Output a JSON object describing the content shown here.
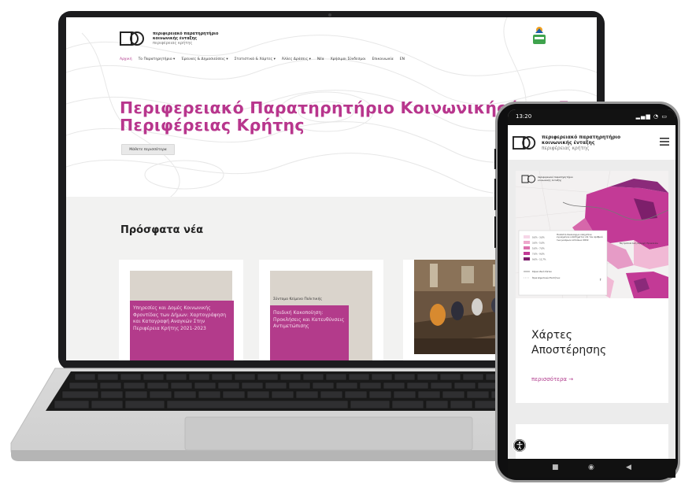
{
  "laptop": {
    "site": {
      "logo_line1": "περιφερειακό παρατηρητήριο",
      "logo_line2": "κοινωνικής ένταξης",
      "logo_line3": "περιφέρειας κρήτης",
      "nav": [
        "Αρχική",
        "Το Παρατηρητήριο ▾",
        "Έρευνες & Δημοσιεύσεις ▾",
        "Στατιστικά & Χάρτες ▾",
        "Άλλες Δράσεις ▾",
        "Νέα",
        "Χρήσιμοι Σύνδεσμοι",
        "Επικοινωνία",
        "EN"
      ],
      "hero_title_line1": "Περιφερειακό Παρατηρητήριο Κοινωνικής Ένταξης",
      "hero_title_line2": "Περιφέρειας Κρήτης",
      "hero_button": "Μάθετε περισσότερα",
      "news_heading": "Πρόσφατα νέα",
      "cards": [
        {
          "category": "",
          "title": "Υπηρεσίες και Δομές Κοινωνικής Φροντίδας των Δήμων: Χαρτογράφηση και Καταγραφή Αναγκών Στην Περιφέρεια Κρήτης 2021-2023"
        },
        {
          "category": "Σύντομο Κείμενο Πολιτικής",
          "title": "Παιδική Κακοποίηση: Προκλήσεις και Κατευθύνσεις Αντιμετώπισης"
        },
        {
          "category": "",
          "title": ""
        }
      ]
    }
  },
  "phone": {
    "time": "13:20",
    "logo_line1": "περιφερειακό παρατηρητήριο",
    "logo_line2": "κοινωνικής ένταξης",
    "logo_line3": "περιφέρειας κρήτης",
    "map": {
      "mini_logo_l1": "περιφερειακό παρατηρητήριο",
      "mini_logo_l2": "κοινωνικής ένταξης",
      "legend_title": "Ποσοστό δικαιούχων ελάχιστου εγγυημένου εισοδήματος επί του αριθμού των μονίμων κατοίκων 2019",
      "legend_items": [
        "0,0% - 3,0%",
        "3,0% - 5,0%",
        "5,0% - 7,0%",
        "7,0% - 9,0%",
        "9,0% - 11,7%"
      ],
      "legend_extra": [
        "Κύρια οδικό δίκτυο",
        "Όρια Δημοτικών Ενοτήτων"
      ],
      "region_label": "Μητροπολιτική περιοχή Ηρακλείου"
    },
    "card_title_line1": "Χάρτες",
    "card_title_line2": "Αποστέρησης",
    "card_link": "περισσότερα →"
  },
  "colors": {
    "accent": "#b8368d",
    "card_pink": "#b33b8b",
    "thumb": "#dad4cc",
    "band": "#f2f2f1"
  }
}
